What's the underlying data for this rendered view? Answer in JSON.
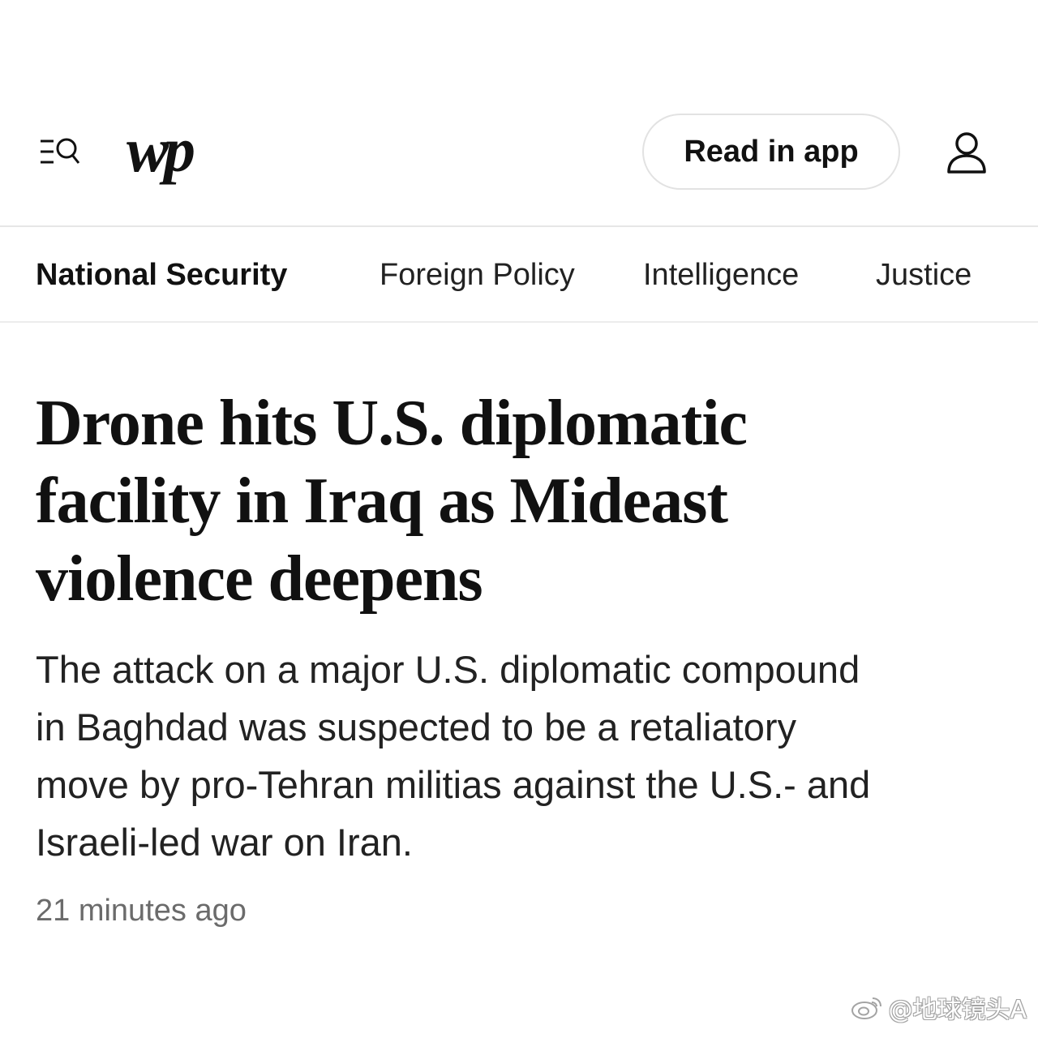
{
  "header": {
    "menu_icon": "menu-search-icon",
    "logo_text": "wp",
    "read_in_app_label": "Read in app",
    "account_icon": "person-icon"
  },
  "nav": {
    "items": [
      {
        "label": "National Security",
        "active": true
      },
      {
        "label": "Foreign Policy",
        "active": false
      },
      {
        "label": "Intelligence",
        "active": false
      },
      {
        "label": "Justice",
        "active": false
      }
    ]
  },
  "article": {
    "headline_lines": [
      "Drone hits U.S. diplomatic",
      "facility in Iraq as Mideast",
      "violence deepens"
    ],
    "summary_lines": [
      "The attack on a major U.S. diplomatic compound",
      "in Baghdad was suspected to be a retaliatory",
      "move by pro-Tehran militias against the U.S.- and",
      "Israeli-led war on Iran."
    ],
    "timestamp": "21 minutes ago"
  },
  "watermark": {
    "icon": "weibo-icon",
    "text": "@地球镜头A"
  }
}
